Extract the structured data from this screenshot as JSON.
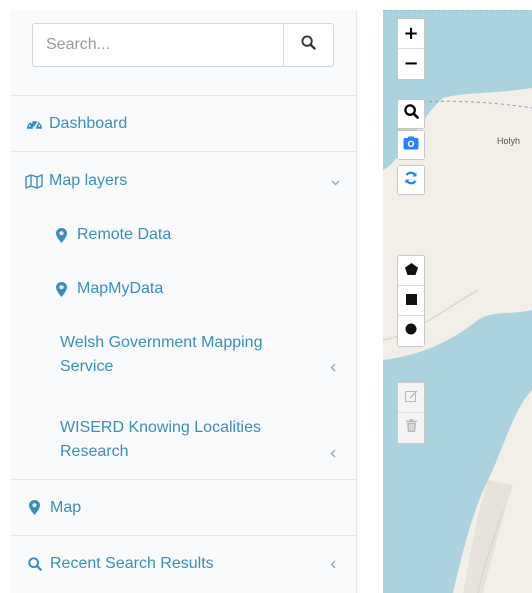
{
  "search": {
    "placeholder": "Search..."
  },
  "menu": {
    "dashboard": "Dashboard",
    "map_layers": "Map layers",
    "remote_data": "Remote Data",
    "mapmydata": "MapMyData",
    "welsh_gov": "Welsh Government Mapping Service",
    "wiserd": "WISERD Knowing Localities Research",
    "map": "Map",
    "recent_search": "Recent Search Results"
  },
  "map": {
    "place_label": "Holyh",
    "controls": [
      "zoom-in",
      "zoom-out",
      "search",
      "camera",
      "refresh",
      "draw-polygon",
      "draw-rectangle",
      "draw-circle",
      "edit",
      "delete"
    ]
  },
  "colors": {
    "accent": "#3c8dbc",
    "sidebar_bg": "#f9fafc",
    "sea": "#aad3df",
    "land": "#f2efe9",
    "control_blue": "#2a7fff"
  }
}
